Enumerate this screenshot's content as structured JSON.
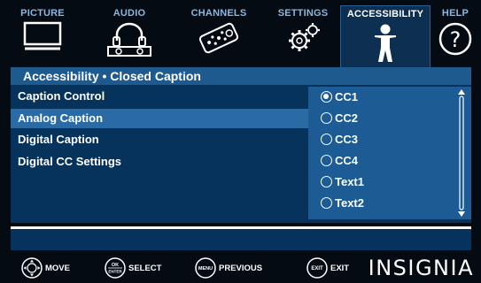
{
  "tabs": [
    {
      "label": "PICTURE",
      "icon": "tv-icon",
      "active": false
    },
    {
      "label": "AUDIO",
      "icon": "headphones-icon",
      "active": false
    },
    {
      "label": "CHANNELS",
      "icon": "remote-icon",
      "active": false
    },
    {
      "label": "SETTINGS",
      "icon": "gears-icon",
      "active": false
    },
    {
      "label": "ACCESSIBILITY",
      "icon": "person-icon",
      "active": true
    },
    {
      "label": "HELP",
      "icon": "help-icon",
      "active": false
    }
  ],
  "header": {
    "title": "Accessibility • Closed Caption"
  },
  "menu": {
    "items": [
      {
        "label": "Caption Control",
        "selected": false
      },
      {
        "label": "Analog Caption",
        "selected": true
      },
      {
        "label": "Digital Caption",
        "selected": false
      },
      {
        "label": "Digital CC Settings",
        "selected": false
      }
    ]
  },
  "options": {
    "items": [
      {
        "label": "CC1",
        "checked": true
      },
      {
        "label": "CC2",
        "checked": false
      },
      {
        "label": "CC3",
        "checked": false
      },
      {
        "label": "CC4",
        "checked": false
      },
      {
        "label": "Text1",
        "checked": false
      },
      {
        "label": "Text2",
        "checked": false
      }
    ]
  },
  "footer": {
    "move": {
      "icon": "dpad-icon",
      "label": "MOVE"
    },
    "select": {
      "icon": "ok-enter-button-icon",
      "icon_text_top": "OK",
      "icon_text_bottom": "ENTER",
      "label": "SELECT"
    },
    "previous": {
      "icon": "menu-button-icon",
      "icon_text": "MENU",
      "label": "PREVIOUS"
    },
    "exit": {
      "icon": "exit-button-icon",
      "icon_text": "EXIT",
      "label": "EXIT"
    },
    "brand": "INSIGNIA"
  },
  "colors": {
    "tab_inactive": "#8bb6e0",
    "header_bg": "#1e5a8e",
    "panel_bg": "#06335c",
    "selected_row": "#2a6ba6",
    "options_bg": "#1c5b93"
  }
}
